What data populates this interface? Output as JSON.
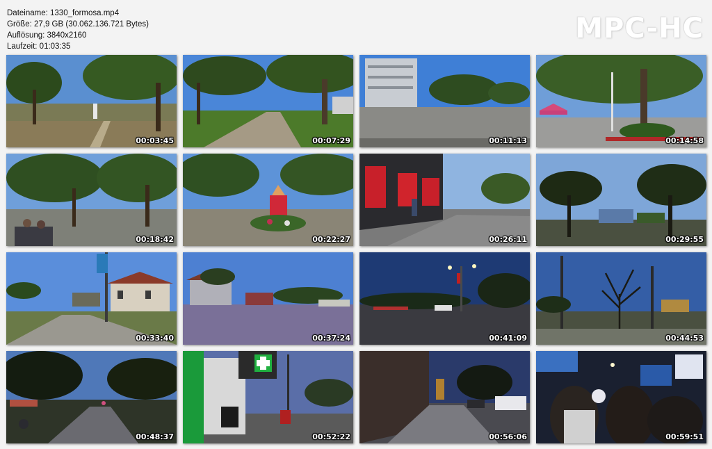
{
  "file_info": {
    "filename": "Dateiname: 1330_formosa.mp4",
    "size": "Größe: 27,9 GB (30.062.136.721 Bytes)",
    "resolution": "Auflösung: 3840x2160",
    "duration": "Laufzeit: 01:03:35"
  },
  "logo": "MPC-HC",
  "thumbnails": [
    {
      "time": "00:03:45"
    },
    {
      "time": "00:07:29"
    },
    {
      "time": "00:11:13"
    },
    {
      "time": "00:14:58"
    },
    {
      "time": "00:18:42"
    },
    {
      "time": "00:22:27"
    },
    {
      "time": "00:26:11"
    },
    {
      "time": "00:29:55"
    },
    {
      "time": "00:33:40"
    },
    {
      "time": "00:37:24"
    },
    {
      "time": "00:41:09"
    },
    {
      "time": "00:44:53"
    },
    {
      "time": "00:48:37"
    },
    {
      "time": "00:52:22"
    },
    {
      "time": "00:56:06"
    },
    {
      "time": "00:59:51"
    }
  ]
}
